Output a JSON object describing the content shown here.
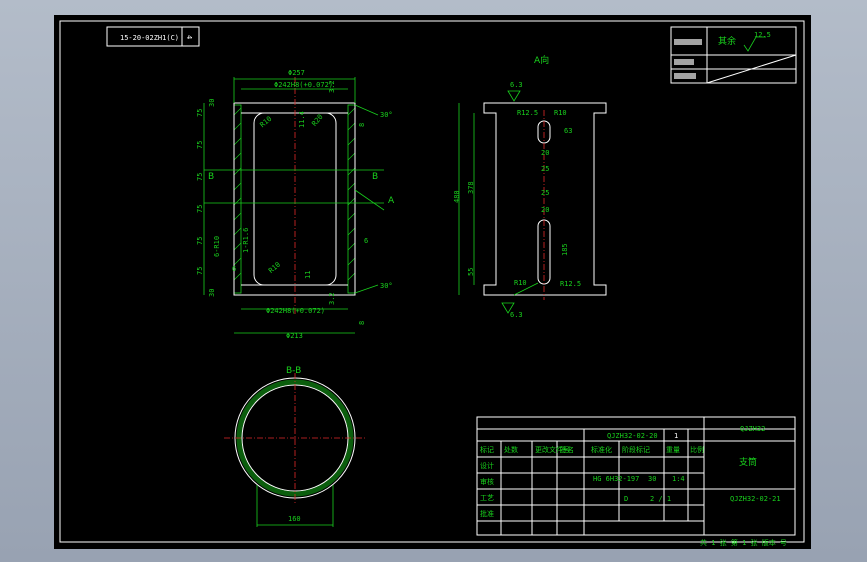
{
  "top_left_box": {
    "code": "15-20-02ZH1(C)",
    "sheet_no": "4"
  },
  "top_right_box": {
    "row1": "其余",
    "roughness": "12.5",
    "labels": [
      "",
      "",
      ""
    ]
  },
  "section_labels": {
    "a_view": "A向",
    "bb": "B-B",
    "a_arrow": "A",
    "b_mark": "B"
  },
  "dims": {
    "left_view": [
      "Φ257",
      "Φ242H8(+0.072)",
      "Φ242H8(+0.072)",
      "Φ213",
      "3.2",
      "3.2",
      "30°",
      "30°",
      "11.4",
      "R20",
      "R10",
      "R10",
      "11",
      "6",
      "6",
      "8",
      "8",
      "1-R1.6",
      "6-R10"
    ],
    "left_vertical": [
      "75",
      "75",
      "75",
      "75",
      "75",
      "75",
      "30",
      "30"
    ],
    "right_view": [
      "6.3",
      "R12.5",
      "R10",
      "63",
      "20",
      "25",
      "25",
      "20",
      "185",
      "R10",
      "R12.5",
      "6.3",
      "480",
      "378",
      "55"
    ],
    "circle": [
      "160"
    ]
  },
  "title_block": {
    "part_no": "QJZH32-02-20",
    "qty": "1",
    "name": "支筒",
    "drawing_no": "QJZH32-02-21",
    "company": "QJZH32",
    "material": "HG 6H32-197",
    "mass": "30",
    "scale": "1:4",
    "sheet": "2 / 1",
    "rev": "D",
    "headers": [
      "标记",
      "处数",
      "分区",
      "更改文件号",
      "签名",
      "年月日"
    ],
    "rows_left": [
      "设计",
      "审核",
      "工艺",
      "批准"
    ],
    "cols_mid": [
      "标准化",
      "阶段标记",
      "重量",
      "比例"
    ],
    "footer": "共 1 张  第 1 张  版本 号"
  }
}
